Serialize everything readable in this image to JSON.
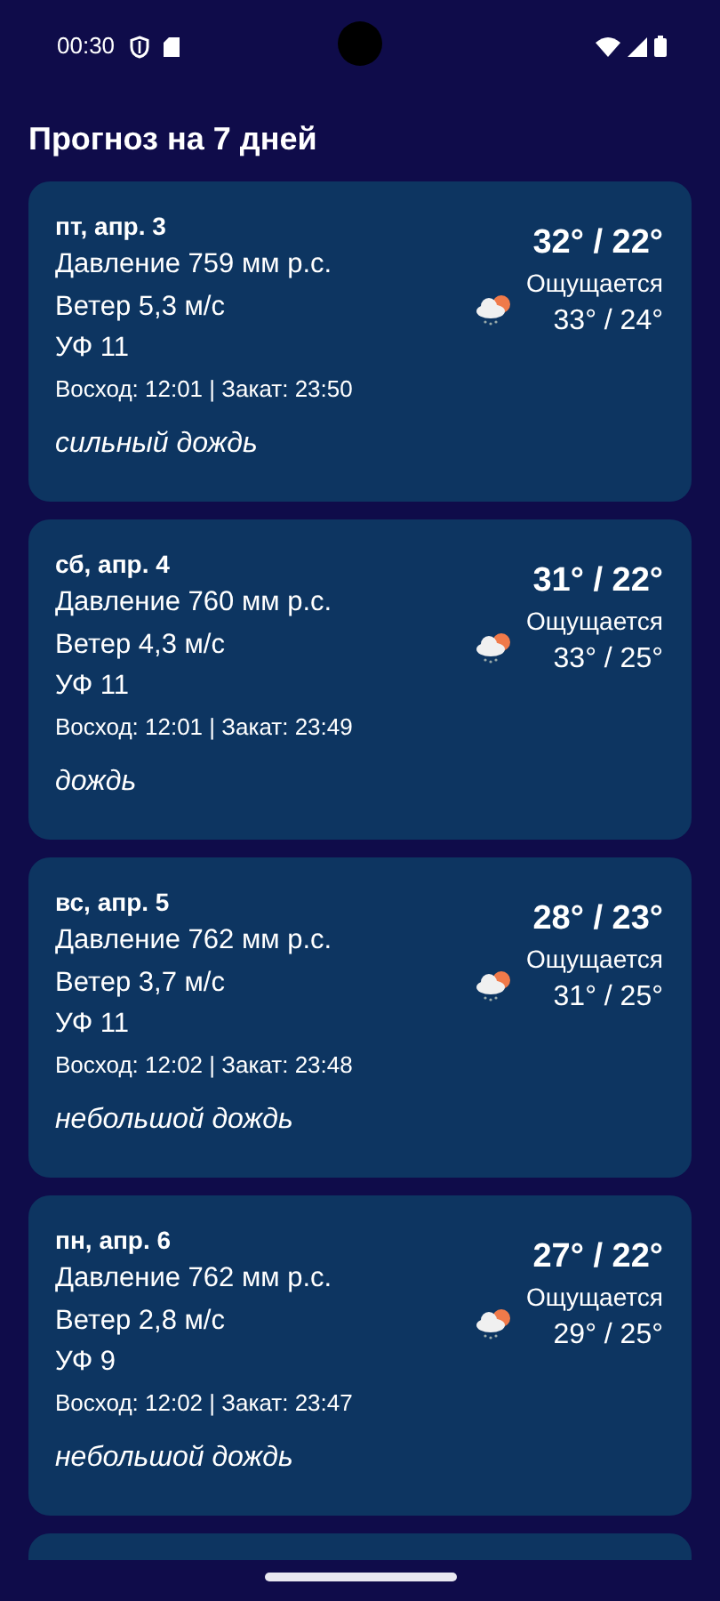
{
  "status_bar": {
    "time": "00:30"
  },
  "title": "Прогноз на 7 дней",
  "days": [
    {
      "date": "пт, апр. 3",
      "pressure": "Давление 759 мм р.с.",
      "wind": "Ветер 5,3 м/с",
      "uv": "УФ 11",
      "sun": "Восход: 12:01 | Закат: 23:50",
      "description": "сильный дождь",
      "temp": "32° / 22°",
      "feels_label": "Ощущается",
      "feels": "33° / 24°"
    },
    {
      "date": "сб, апр. 4",
      "pressure": "Давление 760 мм р.с.",
      "wind": "Ветер 4,3 м/с",
      "uv": "УФ 11",
      "sun": "Восход: 12:01 | Закат: 23:49",
      "description": "дождь",
      "temp": "31° / 22°",
      "feels_label": "Ощущается",
      "feels": "33° / 25°"
    },
    {
      "date": "вс, апр. 5",
      "pressure": "Давление 762 мм р.с.",
      "wind": "Ветер 3,7 м/с",
      "uv": "УФ 11",
      "sun": "Восход: 12:02 | Закат: 23:48",
      "description": "небольшой дождь",
      "temp": "28° / 23°",
      "feels_label": "Ощущается",
      "feels": "31° / 25°"
    },
    {
      "date": "пн, апр. 6",
      "pressure": "Давление 762 мм р.с.",
      "wind": "Ветер 2,8 м/с",
      "uv": "УФ 9",
      "sun": "Восход: 12:02 | Закат: 23:47",
      "description": "небольшой дождь",
      "temp": "27° / 22°",
      "feels_label": "Ощущается",
      "feels": "29° / 25°"
    }
  ]
}
